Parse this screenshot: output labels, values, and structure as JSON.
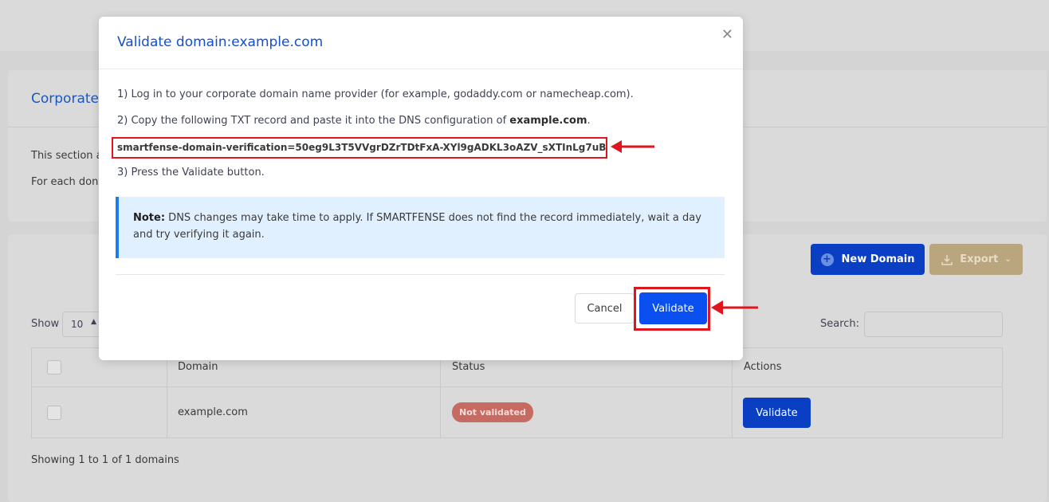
{
  "page": {
    "card_title": "Corporate",
    "desc_line1": "This section a",
    "desc_line2": "For each don"
  },
  "toolbar": {
    "new_domain": "New Domain",
    "export": "Export"
  },
  "table_controls": {
    "show_label": "Show",
    "show_value": "10",
    "search_label": "Search:"
  },
  "table": {
    "headers": [
      "Domain",
      "Status",
      "Actions"
    ],
    "rows": [
      {
        "domain": "example.com",
        "status": "Not validated",
        "action": "Validate"
      }
    ],
    "footer": "Showing 1 to 1 of 1 domains"
  },
  "modal": {
    "title": "Validate domain:example.com",
    "step1": "1) Log in to your corporate domain name provider (for example, godaddy.com or namecheap.com).",
    "step2_prefix": "2) Copy the following TXT record and paste it into the DNS configuration of ",
    "step2_domain": "example.com",
    "step2_suffix": ".",
    "txt_record": "smartfense-domain-verification=50eg9L3T5VVgrDZrTDtFxA-XYl9gADKL3oAZV_sXTInLg7uB",
    "step3": "3) Press the Validate button.",
    "note_label": "Note:",
    "note_text": " DNS changes may take time to apply. If SMARTFENSE does not find the record immediately, wait a day and try verifying it again.",
    "cancel": "Cancel",
    "validate": "Validate"
  },
  "colors": {
    "primary": "#0a4ff0",
    "highlight": "#e0161e",
    "badge": "#c66a62"
  }
}
